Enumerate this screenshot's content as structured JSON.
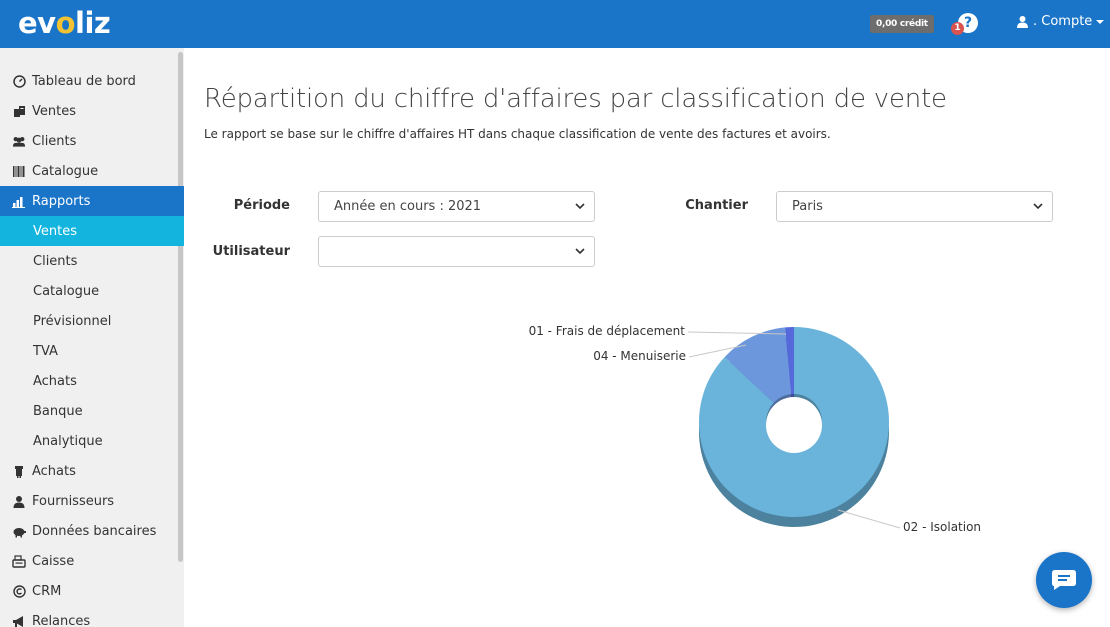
{
  "app": {
    "logo_pre": "ev",
    "logo_acc": "o",
    "logo_post": "liz",
    "credit": "0,00 crédit",
    "help_badge": "1",
    "help_symbol": "?",
    "account": ". Compte"
  },
  "sidebar": {
    "items": [
      {
        "label": "Tableau de bord",
        "icon": "dashboard-icon"
      },
      {
        "label": "Ventes",
        "icon": "sales-icon"
      },
      {
        "label": "Clients",
        "icon": "clients-icon"
      },
      {
        "label": "Catalogue",
        "icon": "barcode-icon"
      },
      {
        "label": "Rapports",
        "icon": "chart-icon"
      },
      {
        "label": "Ventes",
        "sub": true
      },
      {
        "label": "Clients",
        "sub": true
      },
      {
        "label": "Catalogue",
        "sub": true
      },
      {
        "label": "Prévisionnel",
        "sub": true
      },
      {
        "label": "TVA",
        "sub": true
      },
      {
        "label": "Achats",
        "sub": true
      },
      {
        "label": "Banque",
        "sub": true
      },
      {
        "label": "Analytique",
        "sub": true
      },
      {
        "label": "Achats",
        "icon": "purchases-icon"
      },
      {
        "label": "Fournisseurs",
        "icon": "supplier-icon"
      },
      {
        "label": "Données bancaires",
        "icon": "piggy-bank-icon"
      },
      {
        "label": "Caisse",
        "icon": "cash-register-icon"
      },
      {
        "label": "CRM",
        "icon": "crm-icon"
      },
      {
        "label": "Relances",
        "icon": "megaphone-icon"
      }
    ]
  },
  "page": {
    "title": "Répartition du chiffre d'affaires par classification de vente",
    "subtitle": "Le rapport se base sur le chiffre d'affaires HT dans chaque classification de vente des factures et avoirs."
  },
  "filters": {
    "periode_label": "Période",
    "periode_value": "Année en cours : 2021",
    "chantier_label": "Chantier",
    "chantier_value": "Paris",
    "utilisateur_label": "Utilisateur",
    "utilisateur_value": ""
  },
  "colors": {
    "brand": "#1a75c9",
    "active_sub": "#13b5de",
    "isolation": "#6ab4db",
    "menuiserie": "#6c97dc",
    "frais": "#5669da"
  },
  "chart_data": {
    "type": "pie",
    "donut": true,
    "categories": [
      "01 - Frais de déplacement",
      "04 - Menuiserie",
      "02 - Isolation"
    ],
    "values": [
      1.5,
      11.5,
      87
    ],
    "unit_note": "",
    "colors": [
      "#5669da",
      "#6c97dc",
      "#6ab4db"
    ]
  }
}
